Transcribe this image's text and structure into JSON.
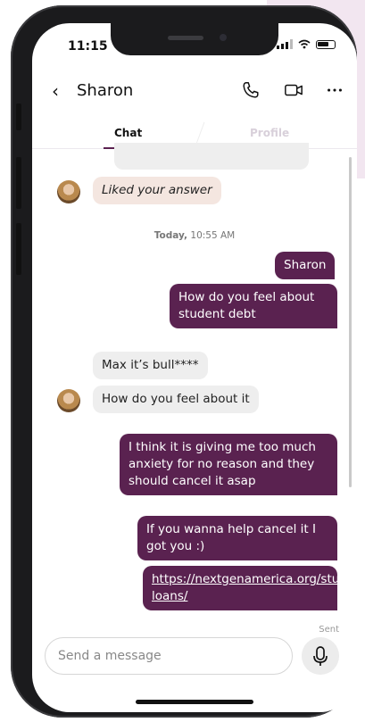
{
  "status_bar": {
    "time": "11:15"
  },
  "header": {
    "contact_name": "Sharon"
  },
  "tabs": [
    {
      "label": "Chat"
    },
    {
      "label": "Profile"
    }
  ],
  "messages": {
    "liked": "Liked your answer",
    "timestamp_day": "Today,",
    "timestamp_time": " 10:55 AM",
    "out_1": "Sharon",
    "out_2": "How do you feel about student debt",
    "in_1": "Max it’s bull****",
    "in_2": "How do you feel about it",
    "out_3": "I think it is giving me too much anxiety for no reason and they should cancel it asap",
    "out_4": "If you wanna help cancel it I got you :)",
    "out_5_link": "https://nextgenamerica.org/student-loans/",
    "sent_label": "Sent"
  },
  "composer": {
    "placeholder": "Send a message"
  },
  "colors": {
    "accent": "#5a2250",
    "incoming": "#eeeeee",
    "liked": "#f4e6e0"
  },
  "icons": [
    "back-chevron-icon",
    "phone-icon",
    "video-camera-icon",
    "more-options-icon",
    "microphone-icon"
  ]
}
